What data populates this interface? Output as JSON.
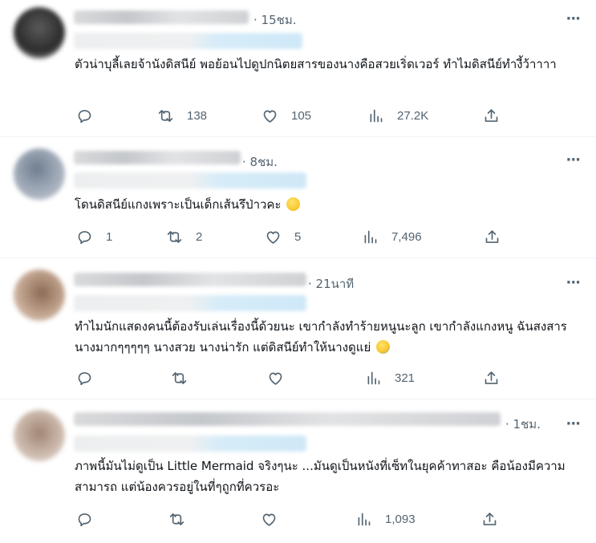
{
  "tweets": [
    {
      "time": "15ชม.",
      "text": "ตัวน่าบุลี้เลยจ้านังดิสนีย์ พอย้อนไปดูปกนิตยสารของนางคือสวยเริ่ดเวอร์ ทำไมดิสนีย์ทำงี้ว้าาาา",
      "emoji": "",
      "reply_count": "",
      "retweet_count": "138",
      "like_count": "105",
      "view_count": "27.2K",
      "avatar_color": "#3a3a3a"
    },
    {
      "time": "8ชม.",
      "text": "โดนดิสนีย์แกงเพราะเป็นเด็กเส้นรึป่าวคะ",
      "emoji": "hot-face-emoji",
      "reply_count": "1",
      "retweet_count": "2",
      "like_count": "5",
      "view_count": "7,496",
      "avatar_color": "#8d98a6"
    },
    {
      "time": "21นาที",
      "text": "ทำไมนักแสดงคนนี้ต้องรับเล่นเรื่องนี้ด้วยนะ เขากำลังทำร้ายหนูนะลูก เขากำลังแกงหนู ฉันสงสารนางมากๆๆๆๆๆ นางสวย นางน่ารัก แต่ดิสนีย์ทำให้นางดูแย่",
      "emoji": "crying-face-emoji",
      "reply_count": "",
      "retweet_count": "",
      "like_count": "",
      "view_count": "321",
      "avatar_color": "#a48a78"
    },
    {
      "time": "1ชม.",
      "text": "ภาพนี้มันไม่ดูเป็น Little Mermaid จริงๆนะ ...มันดูเป็นหนังที่เซ็ทในยุคค้าทาสอะ คือน้องมีความสามารถ แต่น้องควรอยู่ในที่ๆถูกที่ควรอะ",
      "emoji": "",
      "reply_count": "",
      "retweet_count": "",
      "like_count": "",
      "view_count": "1,093",
      "avatar_color": "#b9a79b"
    }
  ],
  "icons": {
    "reply": "reply-icon",
    "retweet": "retweet-icon",
    "like": "heart-icon",
    "views": "views-icon",
    "share": "share-icon",
    "more": "more-icon"
  },
  "more_glyph": "···"
}
